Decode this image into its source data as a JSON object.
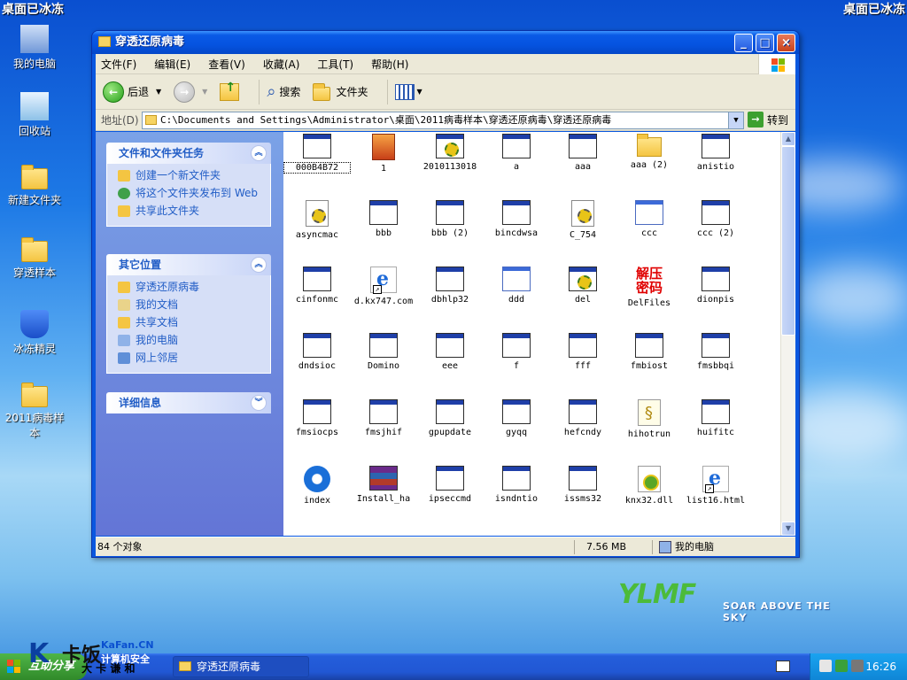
{
  "banner": {
    "left": "桌面已冰冻",
    "right": "桌面已冰冻"
  },
  "desktop_icons": [
    {
      "label": "我的电脑",
      "icon": "computer-icon"
    },
    {
      "label": "回收站",
      "icon": "recycle-bin-icon"
    },
    {
      "label": "新建文件夹",
      "icon": "folder-icon"
    },
    {
      "label": "穿透样本",
      "icon": "folder-icon"
    },
    {
      "label": "冰冻精灵",
      "icon": "shield-icon"
    },
    {
      "label": "2011病毒样本",
      "icon": "folder-icon"
    }
  ],
  "window": {
    "title": "穿透还原病毒",
    "menu": [
      "文件(F)",
      "编辑(E)",
      "查看(V)",
      "收藏(A)",
      "工具(T)",
      "帮助(H)"
    ],
    "toolbar": {
      "back": "后退",
      "search": "搜索",
      "folders": "文件夹"
    },
    "address": {
      "label": "地址(D)",
      "path": "C:\\Documents and Settings\\Administrator\\桌面\\2011病毒样本\\穿透还原病毒\\穿透还原病毒",
      "go": "转到"
    },
    "task_panels": {
      "file_tasks": {
        "title": "文件和文件夹任务",
        "links": [
          "创建一个新文件夹",
          "将这个文件夹发布到 Web",
          "共享此文件夹"
        ]
      },
      "other_places": {
        "title": "其它位置",
        "links": [
          "穿透还原病毒",
          "我的文档",
          "共享文档",
          "我的电脑",
          "网上邻居"
        ]
      },
      "details": {
        "title": "详细信息"
      }
    },
    "files": [
      {
        "name": "000B4B72",
        "icon": "app-icon",
        "selected": true
      },
      {
        "name": "1",
        "icon": "image-file-icon"
      },
      {
        "name": "2010113018",
        "icon": "gear-app-icon"
      },
      {
        "name": "a",
        "icon": "app-icon"
      },
      {
        "name": "aaa",
        "icon": "app-icon"
      },
      {
        "name": "aaa (2)",
        "icon": "folder-icon"
      },
      {
        "name": "anistio",
        "icon": "app-icon"
      },
      {
        "name": "asyncmac",
        "icon": "settings-file-icon"
      },
      {
        "name": "bbb",
        "icon": "app-icon"
      },
      {
        "name": "bbb (2)",
        "icon": "app-icon"
      },
      {
        "name": "bincdwsa",
        "icon": "app-icon"
      },
      {
        "name": "C_754",
        "icon": "settings-file-icon"
      },
      {
        "name": "ccc",
        "icon": "blank-window-icon"
      },
      {
        "name": "ccc (2)",
        "icon": "app-icon"
      },
      {
        "name": "cinfonmc",
        "icon": "app-icon"
      },
      {
        "name": "d.kx747.com",
        "icon": "web-shortcut-icon"
      },
      {
        "name": "dbhlp32",
        "icon": "app-icon"
      },
      {
        "name": "ddd",
        "icon": "blank-window-icon"
      },
      {
        "name": "del",
        "icon": "gear-app-icon"
      },
      {
        "name": "DelFiles",
        "icon": "red-text-icon",
        "icon_text": "解压\n密码"
      },
      {
        "name": "dionpis",
        "icon": "app-icon"
      },
      {
        "name": "dndsioc",
        "icon": "app-icon"
      },
      {
        "name": "Domino",
        "icon": "app-icon"
      },
      {
        "name": "eee",
        "icon": "app-icon"
      },
      {
        "name": "f",
        "icon": "app-icon"
      },
      {
        "name": "fff",
        "icon": "app-icon"
      },
      {
        "name": "fmbiost",
        "icon": "app-icon"
      },
      {
        "name": "fmsbbqi",
        "icon": "app-icon"
      },
      {
        "name": "fmsiocps",
        "icon": "app-icon"
      },
      {
        "name": "fmsjhif",
        "icon": "app-icon"
      },
      {
        "name": "gpupdate",
        "icon": "app-icon"
      },
      {
        "name": "gyqq",
        "icon": "app-icon"
      },
      {
        "name": "hefcndy",
        "icon": "app-icon"
      },
      {
        "name": "hihotrun",
        "icon": "text-file-icon"
      },
      {
        "name": "huifitc",
        "icon": "app-icon"
      },
      {
        "name": "index",
        "icon": "dat-icon"
      },
      {
        "name": "Install_ha",
        "icon": "winrar-icon"
      },
      {
        "name": "ipseccmd",
        "icon": "app-icon"
      },
      {
        "name": "isndntio",
        "icon": "app-icon"
      },
      {
        "name": "issms32",
        "icon": "app-icon"
      },
      {
        "name": "knx32.dll",
        "icon": "dll-icon"
      },
      {
        "name": "list16.html",
        "icon": "web-shortcut-icon"
      }
    ],
    "status": {
      "count": "84 个对象",
      "size": "7.56 MB",
      "location": "我的电脑"
    }
  },
  "taskbar": {
    "start": "互助分享",
    "task": "穿透还原病毒",
    "clock": "16:26"
  },
  "watermarks": {
    "kafan_cn": "KaFan.CN",
    "kafan_sec": "计算机安全",
    "kafan_name": "卡饭",
    "kafan_tag": "大 卡 谦 和",
    "ylmf_logo": "YLMF",
    "ylmf_tag": "SOAR ABOVE THE SKY"
  },
  "colors": {
    "titlebar": "#0553e0",
    "taskpane_link": "#215dc6",
    "taskbar": "#2157d4",
    "start": "#3c9a33"
  }
}
